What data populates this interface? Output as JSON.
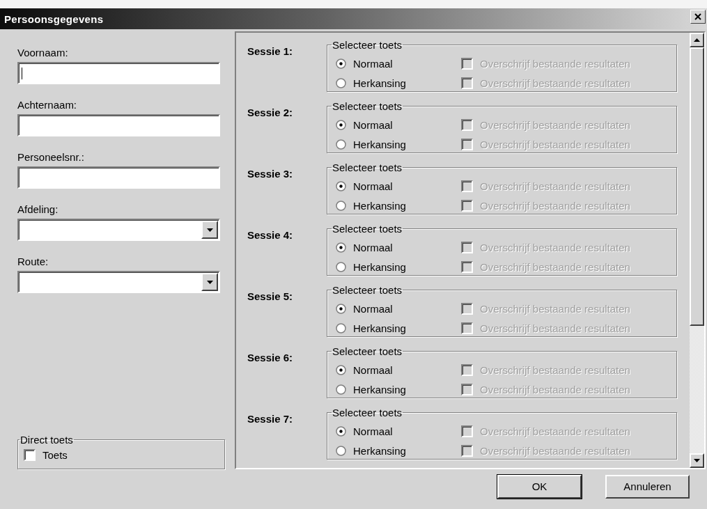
{
  "window": {
    "title": "Persoonsgegevens"
  },
  "fields": [
    {
      "kind": "text",
      "label": "Voornaam:",
      "focused": true
    },
    {
      "kind": "text",
      "label": "Achternaam:",
      "focused": false
    },
    {
      "kind": "text",
      "label": "Personeelsnr.:",
      "focused": false
    },
    {
      "kind": "dropdown",
      "label": "Afdeling:"
    },
    {
      "kind": "dropdown",
      "label": "Route:"
    }
  ],
  "direct_test": {
    "title": "Direct toets",
    "label": "Toets",
    "checked": false
  },
  "sessions": [
    {
      "label": "Sessie 1:",
      "group_title": "Selecteer toets",
      "options": [
        {
          "label": "Normaal",
          "selected": true,
          "overwrite": {
            "label": "Overschrijf bestaande resultaten",
            "checked": false,
            "disabled": true
          }
        },
        {
          "label": "Herkansing",
          "selected": false,
          "overwrite": {
            "label": "Overschrijf bestaande resultaten",
            "checked": false,
            "disabled": true
          }
        }
      ]
    },
    {
      "label": "Sessie 2:",
      "group_title": "Selecteer toets",
      "options": [
        {
          "label": "Normaal",
          "selected": true,
          "overwrite": {
            "label": "Overschrijf bestaande resultaten",
            "checked": false,
            "disabled": true
          }
        },
        {
          "label": "Herkansing",
          "selected": false,
          "overwrite": {
            "label": "Overschrijf bestaande resultaten",
            "checked": false,
            "disabled": true
          }
        }
      ]
    },
    {
      "label": "Sessie 3:",
      "group_title": "Selecteer toets",
      "options": [
        {
          "label": "Normaal",
          "selected": true,
          "overwrite": {
            "label": "Overschrijf bestaande resultaten",
            "checked": false,
            "disabled": true
          }
        },
        {
          "label": "Herkansing",
          "selected": false,
          "overwrite": {
            "label": "Overschrijf bestaande resultaten",
            "checked": false,
            "disabled": true
          }
        }
      ]
    },
    {
      "label": "Sessie 4:",
      "group_title": "Selecteer toets",
      "options": [
        {
          "label": "Normaal",
          "selected": true,
          "overwrite": {
            "label": "Overschrijf bestaande resultaten",
            "checked": false,
            "disabled": true
          }
        },
        {
          "label": "Herkansing",
          "selected": false,
          "overwrite": {
            "label": "Overschrijf bestaande resultaten",
            "checked": false,
            "disabled": true
          }
        }
      ]
    },
    {
      "label": "Sessie 5:",
      "group_title": "Selecteer toets",
      "options": [
        {
          "label": "Normaal",
          "selected": true,
          "overwrite": {
            "label": "Overschrijf bestaande resultaten",
            "checked": false,
            "disabled": true
          }
        },
        {
          "label": "Herkansing",
          "selected": false,
          "overwrite": {
            "label": "Overschrijf bestaande resultaten",
            "checked": false,
            "disabled": true
          }
        }
      ]
    },
    {
      "label": "Sessie 6:",
      "group_title": "Selecteer toets",
      "options": [
        {
          "label": "Normaal",
          "selected": true,
          "overwrite": {
            "label": "Overschrijf bestaande resultaten",
            "checked": false,
            "disabled": true
          }
        },
        {
          "label": "Herkansing",
          "selected": false,
          "overwrite": {
            "label": "Overschrijf bestaande resultaten",
            "checked": false,
            "disabled": true
          }
        }
      ]
    },
    {
      "label": "Sessie 7:",
      "group_title": "Selecteer toets",
      "options": [
        {
          "label": "Normaal",
          "selected": true,
          "overwrite": {
            "label": "Overschrijf bestaande resultaten",
            "checked": false,
            "disabled": true
          }
        },
        {
          "label": "Herkansing",
          "selected": false,
          "overwrite": {
            "label": "Overschrijf bestaande resultaten",
            "checked": false,
            "disabled": true
          }
        }
      ]
    }
  ],
  "buttons": [
    {
      "label": "OK",
      "default": true
    },
    {
      "label": "Annuleren",
      "default": false
    }
  ]
}
